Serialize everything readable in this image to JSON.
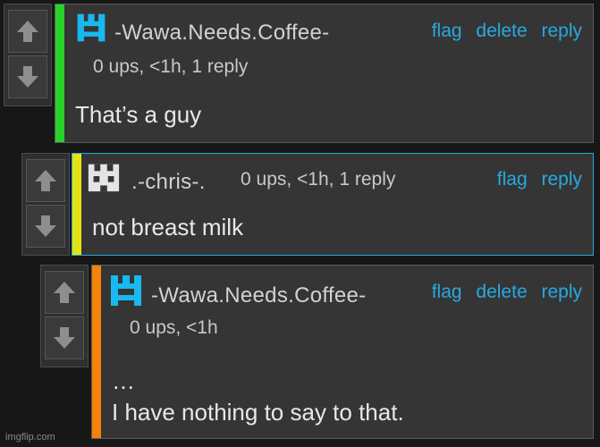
{
  "comments": [
    {
      "username": "-Wawa.Needs.Coffee-",
      "meta": "0 ups, <1h, 1 reply",
      "actions": [
        "flag",
        "delete",
        "reply"
      ],
      "lines": [
        "That’s a guy"
      ],
      "stripe_color": "#2ad12a",
      "avatar_icon": "cyan-chess-piece-icon"
    },
    {
      "username": ".-chris-.",
      "meta": "0 ups, <1h, 1 reply",
      "actions": [
        "flag",
        "reply"
      ],
      "lines": [
        "not breast milk"
      ],
      "stripe_color": "#e3e313",
      "avatar_icon": "white-castle-icon"
    },
    {
      "username": "-Wawa.Needs.Coffee-",
      "meta": "0 ups, <1h",
      "actions": [
        "flag",
        "delete",
        "reply"
      ],
      "lines": [
        "…",
        "I have nothing to say to that."
      ],
      "stripe_color": "#f5820a",
      "avatar_icon": "cyan-chess-piece-icon"
    }
  ],
  "vote": {
    "up_icon": "up-arrow-icon",
    "down_icon": "down-arrow-icon"
  },
  "watermark": "imgflip.com",
  "colors": {
    "link": "#27a9e1",
    "active_border": "#27a9e1",
    "card_bg": "#353535",
    "page_bg": "#171717"
  }
}
